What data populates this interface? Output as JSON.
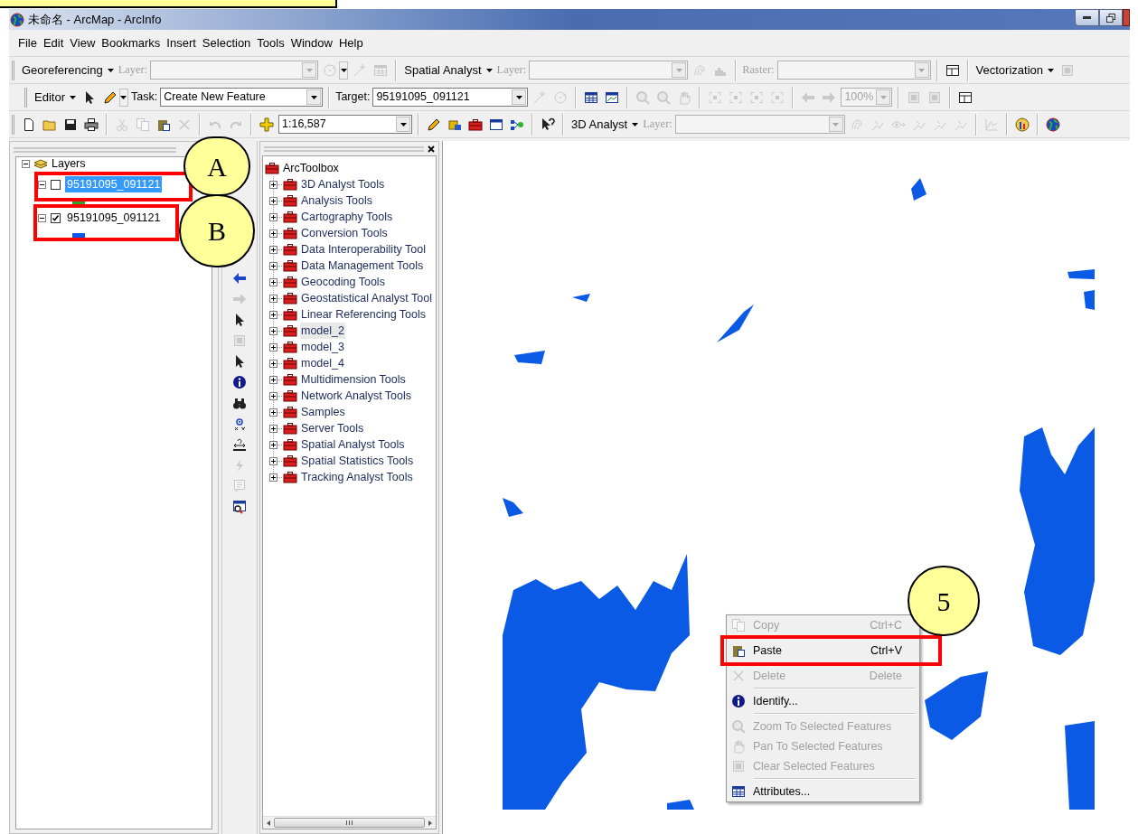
{
  "title_bar": {
    "title": "未命名 - ArcMap - ArcInfo"
  },
  "menu_bar": [
    "File",
    "Edit",
    "View",
    "Bookmarks",
    "Insert",
    "Selection",
    "Tools",
    "Window",
    "Help"
  ],
  "toolbars": [
    {
      "items": [
        {
          "kind": "menu",
          "label": "Georeferencing"
        },
        {
          "kind": "label",
          "label": "Layer:",
          "disabled": true
        },
        {
          "kind": "combo",
          "disabled": true
        },
        {
          "kind": "icon",
          "disabled": true
        },
        {
          "kind": "dropdown",
          "disabled": false
        },
        {
          "kind": "icon",
          "disabled": true
        },
        {
          "kind": "icon",
          "disabled": true
        },
        {
          "kind": "sep"
        },
        {
          "kind": "menu",
          "label": "Spatial Analyst"
        },
        {
          "kind": "label",
          "label": "Layer:",
          "disabled": true
        },
        {
          "kind": "combo",
          "disabled": true
        },
        {
          "kind": "icon",
          "disabled": true
        },
        {
          "kind": "icon",
          "disabled": true
        },
        {
          "kind": "sep"
        },
        {
          "kind": "label",
          "label": "Raster:",
          "disabled": true
        },
        {
          "kind": "combo",
          "disabled": true
        },
        {
          "kind": "sep"
        },
        {
          "kind": "icon",
          "disabled": false
        },
        {
          "kind": "sep"
        },
        {
          "kind": "menu",
          "label": "Vectorization"
        },
        {
          "kind": "icon",
          "disabled": true
        }
      ]
    },
    {
      "items": [
        {
          "kind": "menu",
          "label": "Editor"
        },
        {
          "kind": "icon",
          "disabled": false
        },
        {
          "kind": "icon",
          "disabled": false
        },
        {
          "kind": "dropdown",
          "disabled": false
        },
        {
          "kind": "label",
          "label": "Task:",
          "disabled": false
        },
        {
          "kind": "combo",
          "value": "Create New Feature",
          "disabled": false
        },
        {
          "kind": "sep"
        },
        {
          "kind": "label",
          "label": "Target:",
          "disabled": false
        },
        {
          "kind": "combo",
          "value": "95191095_091121",
          "disabled": false
        },
        {
          "kind": "icon",
          "disabled": true
        },
        {
          "kind": "icon",
          "disabled": true
        },
        {
          "kind": "sep"
        },
        {
          "kind": "icon",
          "disabled": false
        },
        {
          "kind": "icon",
          "disabled": false
        },
        {
          "kind": "sep"
        },
        {
          "kind": "icon",
          "disabled": true
        },
        {
          "kind": "icon",
          "disabled": true
        },
        {
          "kind": "icon",
          "disabled": true
        },
        {
          "kind": "sep"
        },
        {
          "kind": "icon",
          "disabled": true
        },
        {
          "kind": "icon",
          "disabled": true
        },
        {
          "kind": "icon",
          "disabled": true
        },
        {
          "kind": "icon",
          "disabled": true
        },
        {
          "kind": "sep"
        },
        {
          "kind": "icon",
          "disabled": true
        },
        {
          "kind": "icon",
          "disabled": true
        },
        {
          "kind": "combo",
          "value": "100%",
          "disabled": true
        },
        {
          "kind": "sep"
        },
        {
          "kind": "icon",
          "disabled": true
        },
        {
          "kind": "icon",
          "disabled": true
        },
        {
          "kind": "sep"
        },
        {
          "kind": "icon",
          "disabled": false
        }
      ]
    },
    {
      "items": [
        {
          "kind": "icon",
          "disabled": false
        },
        {
          "kind": "icon",
          "disabled": false
        },
        {
          "kind": "icon",
          "disabled": false
        },
        {
          "kind": "icon",
          "disabled": false
        },
        {
          "kind": "sep"
        },
        {
          "kind": "icon",
          "disabled": true
        },
        {
          "kind": "icon",
          "disabled": true
        },
        {
          "kind": "icon",
          "disabled": false
        },
        {
          "kind": "icon",
          "disabled": true
        },
        {
          "kind": "sep"
        },
        {
          "kind": "icon",
          "disabled": true
        },
        {
          "kind": "icon",
          "disabled": true
        },
        {
          "kind": "sep"
        },
        {
          "kind": "icon",
          "disabled": false
        },
        {
          "kind": "combo",
          "value": "1:16,587",
          "disabled": false
        },
        {
          "kind": "sep"
        },
        {
          "kind": "icon",
          "disabled": false
        },
        {
          "kind": "icon",
          "disabled": false
        },
        {
          "kind": "icon",
          "disabled": false
        },
        {
          "kind": "icon",
          "disabled": false
        },
        {
          "kind": "icon",
          "disabled": false
        },
        {
          "kind": "sep"
        },
        {
          "kind": "icon",
          "disabled": false
        },
        {
          "kind": "sep"
        },
        {
          "kind": "menu",
          "label": "3D Analyst"
        },
        {
          "kind": "label",
          "label": "Layer:",
          "disabled": true
        },
        {
          "kind": "combo",
          "disabled": true
        },
        {
          "kind": "icon",
          "disabled": true
        },
        {
          "kind": "icon",
          "disabled": true
        },
        {
          "kind": "icon",
          "disabled": true
        },
        {
          "kind": "icon",
          "disabled": true
        },
        {
          "kind": "icon",
          "disabled": true
        },
        {
          "kind": "icon",
          "disabled": true
        },
        {
          "kind": "sep"
        },
        {
          "kind": "icon",
          "disabled": true
        },
        {
          "kind": "sep"
        },
        {
          "kind": "icon",
          "disabled": false
        },
        {
          "kind": "sep"
        },
        {
          "kind": "icon",
          "disabled": false
        }
      ]
    }
  ],
  "table_of_contents": {
    "label": "Layers",
    "expanded": true,
    "children": [
      {
        "label": "95191095_091121",
        "expanded": true,
        "checked": false,
        "selected": true,
        "color": "#33a02c"
      },
      {
        "label": "95191095_091121",
        "expanded": true,
        "checked": true,
        "selected": false,
        "color": "#0a5ae6"
      }
    ]
  },
  "tools_strip": [
    {
      "disabled": false
    },
    {
      "disabled": true
    },
    {
      "disabled": false
    },
    {
      "disabled": true
    },
    {
      "disabled": false
    },
    {
      "disabled": false
    },
    {
      "disabled": false
    },
    {
      "disabled": false
    },
    {
      "disabled": false
    },
    {
      "disabled": true
    },
    {
      "disabled": true
    },
    {
      "disabled": false
    }
  ],
  "toolbox": {
    "label": "ArcToolbox",
    "expanded": true,
    "children": [
      {
        "label": "3D Analyst Tools",
        "selected": false
      },
      {
        "label": "Analysis Tools",
        "selected": false
      },
      {
        "label": "Cartography Tools",
        "selected": false
      },
      {
        "label": "Conversion Tools",
        "selected": false
      },
      {
        "label": "Data Interoperability Tool",
        "selected": false
      },
      {
        "label": "Data Management Tools",
        "selected": false
      },
      {
        "label": "Geocoding Tools",
        "selected": false
      },
      {
        "label": "Geostatistical Analyst Tool",
        "selected": false
      },
      {
        "label": "Linear Referencing Tools",
        "selected": false
      },
      {
        "label": "model_2",
        "selected": true
      },
      {
        "label": "model_3",
        "selected": false
      },
      {
        "label": "model_4",
        "selected": false
      },
      {
        "label": "Multidimension Tools",
        "selected": false
      },
      {
        "label": "Network Analyst Tools",
        "selected": false
      },
      {
        "label": "Samples",
        "selected": false
      },
      {
        "label": "Server Tools",
        "selected": false
      },
      {
        "label": "Spatial Analyst Tools",
        "selected": false
      },
      {
        "label": "Spatial Statistics Tools",
        "selected": false
      },
      {
        "label": "Tracking Analyst Tools",
        "selected": false
      }
    ]
  },
  "context_menu": [
    {
      "kind": "item",
      "label": "Copy",
      "shortcut": "Ctrl+C",
      "disabled": true
    },
    {
      "kind": "item",
      "label": "Paste",
      "shortcut": "Ctrl+V",
      "disabled": false
    },
    {
      "kind": "item",
      "label": "Delete",
      "shortcut": "Delete",
      "disabled": true
    },
    {
      "kind": "separator"
    },
    {
      "kind": "item",
      "label": "Identify...",
      "disabled": false
    },
    {
      "kind": "separator"
    },
    {
      "kind": "item",
      "label": "Zoom To Selected Features",
      "disabled": true
    },
    {
      "kind": "item",
      "label": "Pan To Selected Features",
      "disabled": true
    },
    {
      "kind": "item",
      "label": "Clear Selected Features",
      "disabled": true
    },
    {
      "kind": "separator"
    },
    {
      "kind": "item",
      "label": "Attributes...",
      "disabled": false
    }
  ],
  "annotations": [
    {
      "label": "A"
    },
    {
      "label": "B"
    },
    {
      "label": "5"
    }
  ]
}
